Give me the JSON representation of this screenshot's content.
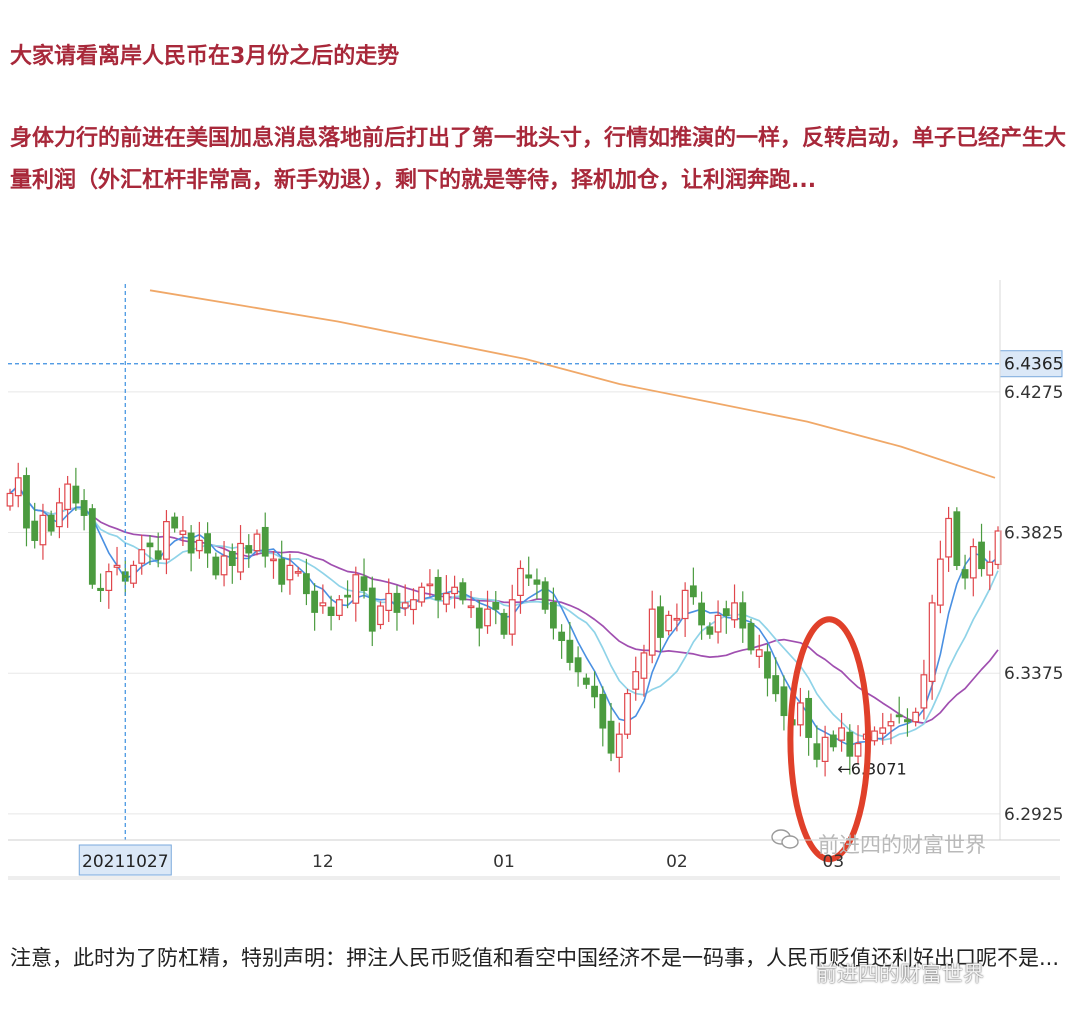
{
  "heading": "大家请看离岸人民币在3月份之后的走势",
  "paragraph": "身体力行的前进在美国加息消息落地前后打出了第一批头寸，行情如推演的一样，反转启动，单子已经产生大量利润（外汇杠杆非常高，新手劝退），剩下的就是等待，择机加仓，让利润奔跑...",
  "footer_text": "注意，此时为了防杠精，特别声明：押注人民币贬值和看空中国经济不是一码事，人民币贬值还利好出口呢不是...",
  "watermark": "前进四的财富世界",
  "colors": {
    "title_red": "#a8283a",
    "candle_up": "#e0474c",
    "candle_down": "#4b9b3f",
    "ma_short": "#4a90e2",
    "ma_mid": "#8fd3e8",
    "ma_long": "#a04fb0",
    "ma_longest": "#f0a868",
    "crosshair": "#3b8fe0",
    "circle": "#e0402a"
  },
  "chart_data": {
    "type": "candlestick",
    "y_ticks": [
      "6.4275",
      "6.3825",
      "6.3375",
      "6.2925"
    ],
    "y_tick_values": [
      6.4275,
      6.3825,
      6.3375,
      6.2925
    ],
    "ylim": [
      6.288,
      6.462
    ],
    "x_ticks": [
      {
        "label": "12",
        "index": 38
      },
      {
        "label": "01",
        "index": 60
      },
      {
        "label": "02",
        "index": 81
      },
      {
        "label": "03",
        "index": 100
      }
    ],
    "crosshair": {
      "date_label": "20211027",
      "price_label": "6.4365",
      "index": 14,
      "price": 6.4365
    },
    "annotation": {
      "label": "←6.3071",
      "index": 100,
      "price": 6.3071
    },
    "circle_range": {
      "index_from": 96,
      "index_to": 103,
      "price_from": 6.297,
      "price_to": 6.355
    },
    "ma_longest": [
      6.46,
      6.455,
      6.45,
      6.444,
      6.438,
      6.43,
      6.424,
      6.418,
      6.41,
      6.4
    ],
    "closes": [
      6.395,
      6.4,
      6.384,
      6.38,
      6.388,
      6.383,
      6.392,
      6.398,
      6.392,
      6.388,
      6.366,
      6.364,
      6.37,
      6.372,
      6.367,
      6.372,
      6.377,
      6.378,
      6.374,
      6.386,
      6.384,
      6.383,
      6.376,
      6.38,
      6.376,
      6.369,
      6.375,
      6.372,
      6.379,
      6.376,
      6.382,
      6.375,
      6.374,
      6.366,
      6.372,
      6.37,
      6.363,
      6.357,
      6.36,
      6.356,
      6.361,
      6.362,
      6.369,
      6.364,
      6.351,
      6.359,
      6.363,
      6.357,
      6.36,
      6.361,
      6.365,
      6.366,
      6.361,
      6.363,
      6.365,
      6.361,
      6.359,
      6.352,
      6.358,
      6.358,
      6.35,
      6.361,
      6.371,
      6.368,
      6.366,
      6.358,
      6.352,
      6.348,
      6.341,
      6.338,
      6.334,
      6.33,
      6.32,
      6.312,
      6.318,
      6.331,
      6.338,
      6.344,
      6.358,
      6.349,
      6.356,
      6.355,
      6.364,
      6.362,
      6.353,
      6.35,
      6.356,
      6.356,
      6.36,
      6.352,
      6.345,
      6.345,
      6.336,
      6.331,
      6.324,
      6.321,
      6.328,
      6.317,
      6.31,
      6.317,
      6.314,
      6.32,
      6.311,
      6.315,
      6.318,
      6.319,
      6.32,
      6.322,
      6.324,
      6.322,
      6.325,
      6.337,
      6.36,
      6.374,
      6.387,
      6.372,
      6.368,
      6.378,
      6.371,
      6.373,
      6.383
    ]
  }
}
